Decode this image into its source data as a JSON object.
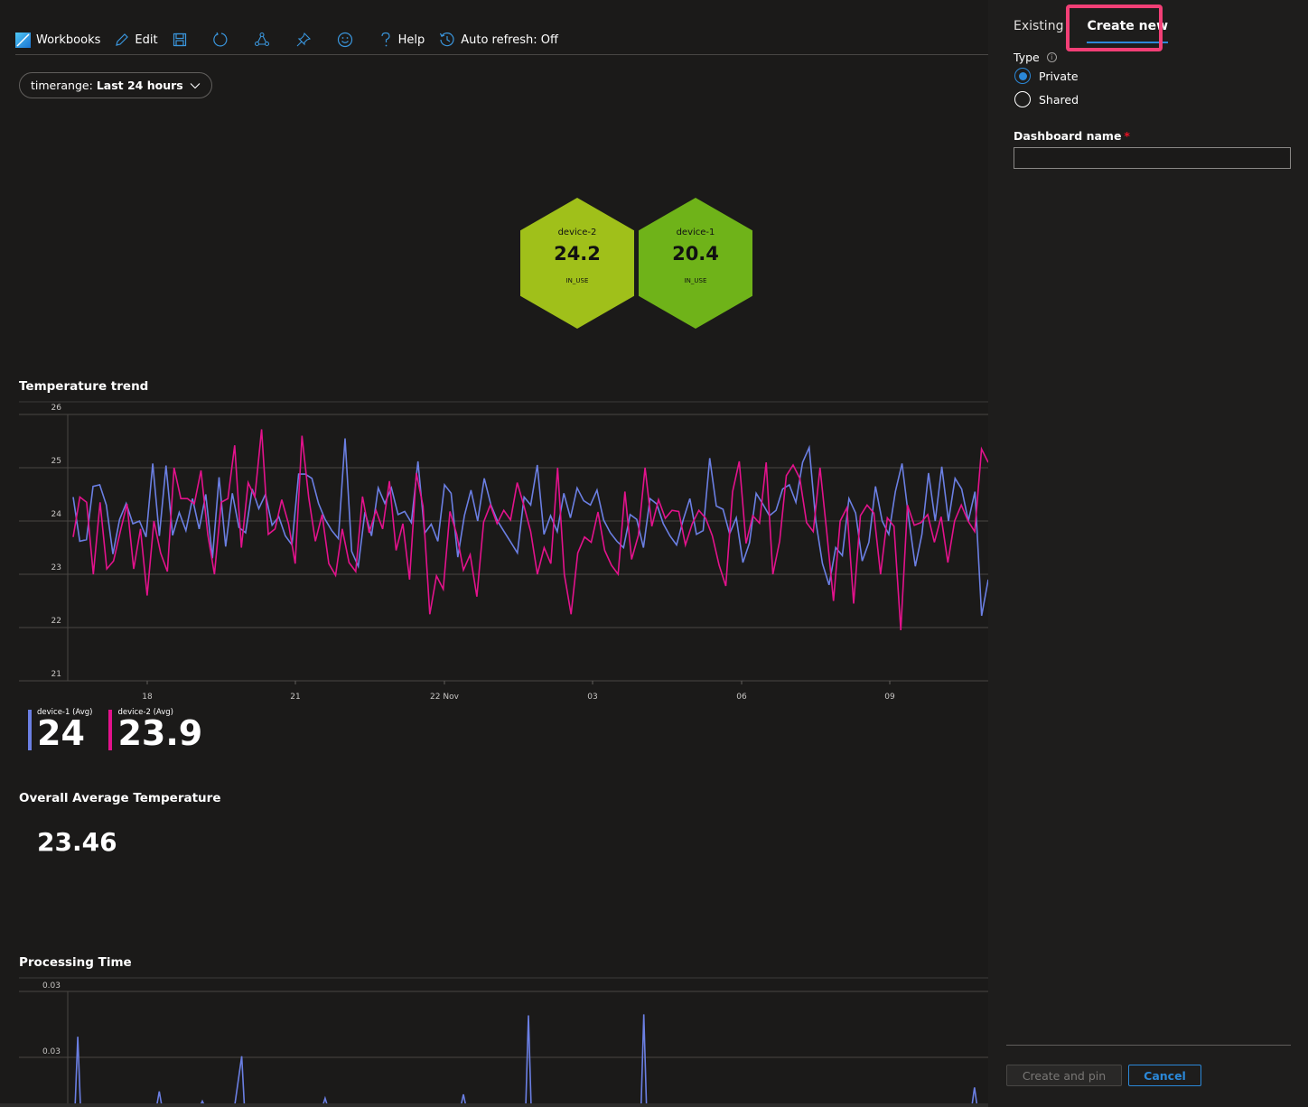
{
  "toolbar": {
    "app_label": "Workbooks",
    "edit_label": "Edit",
    "help_label": "Help",
    "auto_refresh_label": "Auto refresh: Off",
    "icons": [
      "workbooks-logo-icon",
      "edit-pencil-icon",
      "save-icon",
      "refresh-icon",
      "share-icon",
      "pin-icon",
      "feedback-smiley-icon",
      "help-question-icon",
      "history-clock-icon"
    ]
  },
  "timerange": {
    "prefix": "timerange:",
    "value": "Last 24 hours"
  },
  "tiles": [
    {
      "name": "device-2",
      "value": "24.2",
      "status": "IN_USE",
      "color": "#a0c01a"
    },
    {
      "name": "device-1",
      "value": "20.4",
      "status": "IN_USE",
      "color": "#6fb319"
    }
  ],
  "temperature": {
    "title": "Temperature trend",
    "legend": [
      {
        "label": "device-1 (Avg)",
        "value": "24",
        "color": "#6b7fe3"
      },
      {
        "label": "device-2 (Avg)",
        "value": "23.9",
        "color": "#e3128c"
      }
    ]
  },
  "overall": {
    "title": "Overall Average Temperature",
    "value": "23.46"
  },
  "processing": {
    "title": "Processing Time"
  },
  "chart_data": [
    {
      "type": "line",
      "title": "Temperature trend",
      "xlabel": "",
      "ylabel": "",
      "ylim": [
        21,
        26
      ],
      "yticks": [
        "26",
        "25",
        "24",
        "23",
        "22",
        "21"
      ],
      "xticks": [
        "18",
        "21",
        "22 Nov",
        "03",
        "06",
        "09"
      ],
      "grid": true,
      "series": [
        {
          "name": "device-1",
          "color": "#6b7fe3",
          "values": [
            24.45,
            23.62,
            23.65,
            24.65,
            24.68,
            24.3,
            23.38,
            24.03,
            24.33,
            23.95,
            24.0,
            23.7,
            25.08,
            23.72,
            25.04,
            23.73,
            24.16,
            23.82,
            24.42,
            23.85,
            24.5,
            23.3,
            24.82,
            23.52,
            24.52,
            23.88,
            23.78,
            24.6,
            24.23,
            24.5,
            23.92,
            24.08,
            23.72,
            23.55,
            24.88,
            24.88,
            24.8,
            24.33,
            24.03,
            23.82,
            23.67,
            25.55,
            23.43,
            23.15,
            24.17,
            23.72,
            24.62,
            24.33,
            24.62,
            24.12,
            24.18,
            23.97,
            25.12,
            23.77,
            23.94,
            23.62,
            24.68,
            24.52,
            23.32,
            24.1,
            24.58,
            24.0,
            24.8,
            24.3,
            24.0,
            23.8,
            23.6,
            23.4,
            24.45,
            24.3,
            25.05,
            23.75,
            24.1,
            23.8,
            24.52,
            24.06,
            24.62,
            24.38,
            24.3,
            24.58,
            24.02,
            23.78,
            23.62,
            23.5,
            24.12,
            24.03,
            23.5,
            24.42,
            24.32,
            23.95,
            23.72,
            23.55,
            24.02,
            24.42,
            23.75,
            23.82,
            25.18,
            24.28,
            24.22,
            23.76,
            24.06,
            23.22,
            23.59,
            24.52,
            24.32,
            24.1,
            24.2,
            24.6,
            24.68,
            24.35,
            25.1,
            25.38,
            24.0,
            23.2,
            22.8,
            23.5,
            23.35,
            24.42,
            24.15,
            23.25,
            23.6,
            24.65,
            24.0,
            23.75,
            24.55,
            25.08,
            24.06,
            23.15,
            23.75,
            24.9,
            24.0,
            25.02,
            24.0,
            24.8,
            24.6,
            24.0,
            24.55,
            22.22,
            22.9
          ]
        },
        {
          "name": "device-2",
          "color": "#e3128c",
          "values": [
            23.7,
            24.45,
            24.35,
            23.0,
            24.35,
            23.1,
            23.25,
            23.8,
            24.32,
            23.1,
            23.85,
            22.6,
            24.0,
            23.4,
            23.05,
            25.0,
            24.42,
            24.42,
            24.32,
            24.95,
            23.75,
            23.0,
            24.35,
            24.42,
            25.42,
            23.5,
            24.72,
            24.45,
            25.72,
            23.75,
            23.85,
            24.4,
            23.95,
            23.2,
            25.6,
            24.45,
            23.62,
            24.12,
            23.2,
            22.98,
            23.85,
            23.22,
            23.05,
            24.46,
            23.78,
            24.2,
            23.85,
            24.75,
            23.45,
            23.95,
            22.9,
            24.9,
            24.28,
            22.25,
            22.97,
            22.72,
            24.18,
            23.75,
            23.08,
            23.37,
            22.58,
            23.98,
            24.3,
            23.95,
            24.2,
            24.02,
            24.72,
            24.28,
            23.8,
            23.0,
            23.5,
            23.2,
            25.0,
            23.0,
            22.25,
            23.4,
            23.7,
            23.6,
            24.17,
            23.45,
            23.17,
            23.0,
            24.55,
            23.28,
            23.73,
            25.0,
            23.9,
            24.4,
            24.05,
            24.2,
            24.18,
            23.55,
            23.95,
            24.2,
            24.05,
            23.72,
            23.17,
            22.78,
            24.55,
            25.12,
            23.58,
            24.1,
            23.96,
            25.1,
            23.0,
            23.62,
            24.85,
            25.05,
            24.8,
            23.97,
            23.8,
            25.0,
            23.8,
            22.5,
            24.0,
            24.25,
            22.45,
            24.1,
            24.3,
            24.15,
            23.0,
            24.06,
            23.9,
            21.95,
            24.3,
            23.92,
            23.97,
            24.12,
            23.6,
            24.08,
            23.22,
            24.0,
            24.3,
            24.0,
            23.8,
            25.35,
            25.1
          ]
        }
      ]
    },
    {
      "type": "line",
      "title": "Processing Time",
      "yticks": [
        "0.03",
        "0.03"
      ],
      "grid": true,
      "series": [
        {
          "name": "processing-time",
          "color": "#6b7fe3",
          "spikes": [
            {
              "x_frac": 0.006,
              "level": 0.72
            },
            {
              "x_frac": 0.095,
              "level": 0.16
            },
            {
              "x_frac": 0.142,
              "level": 0.06
            },
            {
              "x_frac": 0.185,
              "level": 0.52
            },
            {
              "x_frac": 0.276,
              "level": 0.09
            },
            {
              "x_frac": 0.427,
              "level": 0.13
            },
            {
              "x_frac": 0.498,
              "level": 0.94
            },
            {
              "x_frac": 0.624,
              "level": 0.95
            },
            {
              "x_frac": 0.985,
              "level": 0.2
            }
          ]
        }
      ]
    }
  ],
  "panel": {
    "tabs": [
      {
        "label": "Existing",
        "active": false
      },
      {
        "label": "Create new",
        "active": true
      }
    ],
    "type_label": "Type",
    "type_options": [
      {
        "label": "Private",
        "checked": true
      },
      {
        "label": "Shared",
        "checked": false
      }
    ],
    "dashboard_name_label": "Dashboard name",
    "dashboard_name_value": "",
    "create_button": "Create and pin",
    "cancel_button": "Cancel"
  }
}
